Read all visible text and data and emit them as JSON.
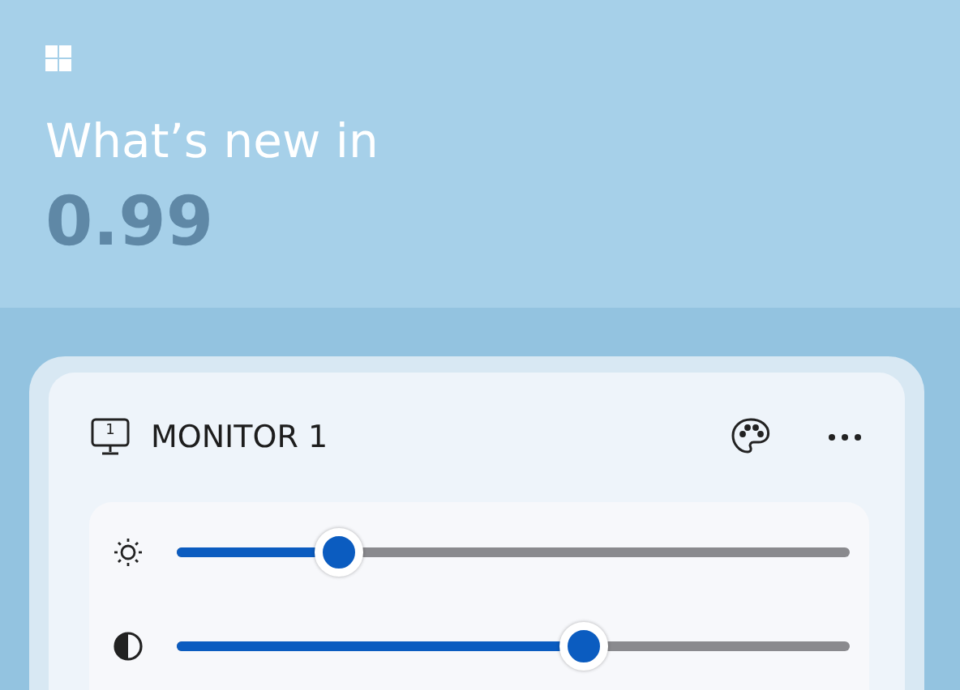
{
  "hero": {
    "title": "What’s new in",
    "version": "0.99"
  },
  "monitor": {
    "icon_number": "1",
    "name": "MONITOR 1",
    "sliders": [
      {
        "kind": "brightness",
        "level": 0.24
      },
      {
        "kind": "contrast",
        "level": 0.605
      }
    ]
  }
}
